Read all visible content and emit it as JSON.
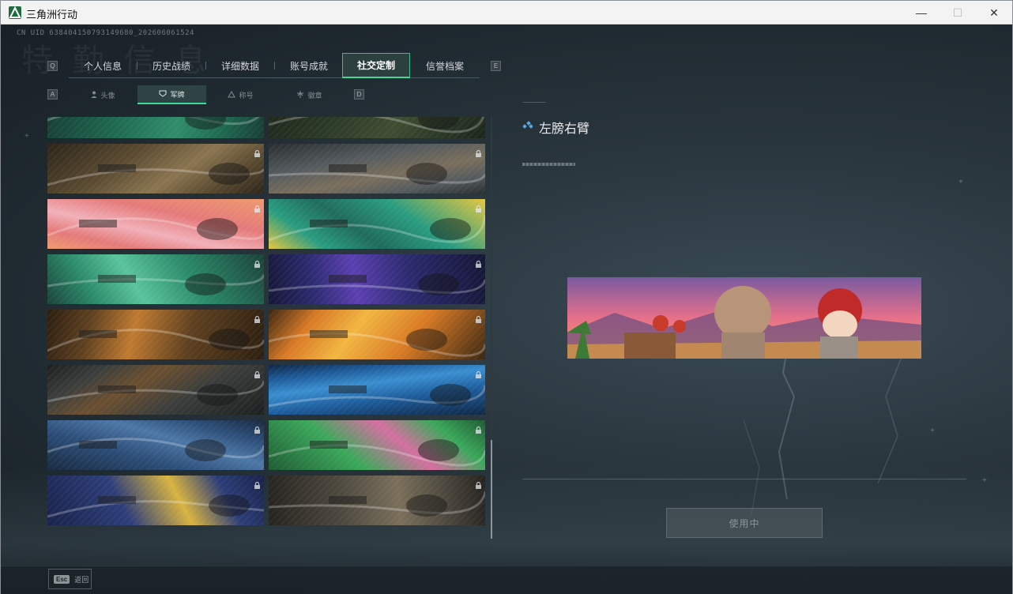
{
  "window": {
    "title": "三角洲行动",
    "minimize": "—",
    "maximize": "☐",
    "close": "✕"
  },
  "header": {
    "uid": "CN UID 638404150793149680_202606061524",
    "bg_title": "特 勤 信 息"
  },
  "tabs": {
    "prev_key": "Q",
    "next_key": "E",
    "items": [
      {
        "label": "个人信息",
        "active": false
      },
      {
        "label": "历史战绩",
        "active": false
      },
      {
        "label": "详细数据",
        "active": false
      },
      {
        "label": "账号成就",
        "active": false
      },
      {
        "label": "社交定制",
        "active": true
      },
      {
        "label": "信誉档案",
        "active": false
      }
    ]
  },
  "subtabs": {
    "prev_key": "A",
    "next_key": "D",
    "items": [
      {
        "label": "头像",
        "icon": "person-icon",
        "active": false
      },
      {
        "label": "军牌",
        "icon": "shield-icon",
        "active": true
      },
      {
        "label": "称号",
        "icon": "triangle-icon",
        "active": false
      },
      {
        "label": "徽章",
        "icon": "badge-icon",
        "active": false
      }
    ]
  },
  "cards": [
    {
      "name": "card-drone-green",
      "colors": [
        "#1f6b52",
        "#2f8d6b",
        "#183d33"
      ],
      "locked": false,
      "selected": true
    },
    {
      "name": "card-dark-camo",
      "colors": [
        "#2c3a28",
        "#3f4d32",
        "#1b2418"
      ],
      "locked": false
    },
    {
      "name": "card-desert-convoy",
      "colors": [
        "#5a4a30",
        "#8a7550",
        "#2d251a"
      ],
      "locked": true
    },
    {
      "name": "card-tank-battle",
      "colors": [
        "#555b5e",
        "#7a6e5c",
        "#2a2e30"
      ],
      "locked": true
    },
    {
      "name": "card-pink-cats",
      "colors": [
        "#e47a7a",
        "#f1b0b8",
        "#ee9a6e"
      ],
      "locked": true
    },
    {
      "name": "card-teal-thumbs",
      "colors": [
        "#2a9d80",
        "#1f6b5c",
        "#e3c640"
      ],
      "locked": true
    },
    {
      "name": "card-green-drone-hand",
      "colors": [
        "#2b8a6a",
        "#59c49b",
        "#1b4238"
      ],
      "locked": true
    },
    {
      "name": "card-purple-lightning",
      "colors": [
        "#2a2a6e",
        "#5b3fb0",
        "#161636"
      ],
      "locked": true
    },
    {
      "name": "card-soldiers-fire",
      "colors": [
        "#5e4020",
        "#c07a30",
        "#2c1e10"
      ],
      "locked": true
    },
    {
      "name": "card-orange-burst",
      "colors": [
        "#d87a25",
        "#f2b640",
        "#3a2612"
      ],
      "locked": true
    },
    {
      "name": "card-ruins-office",
      "colors": [
        "#3a3d3c",
        "#6b4f30",
        "#1d1f1f"
      ],
      "locked": true
    },
    {
      "name": "card-blue-wave",
      "colors": [
        "#1d5b9a",
        "#3a8fd0",
        "#0f2744"
      ],
      "locked": true
    },
    {
      "name": "card-blue-spider",
      "colors": [
        "#2c4e78",
        "#4d77a6",
        "#182a40"
      ],
      "locked": true
    },
    {
      "name": "card-green-pink",
      "colors": [
        "#3aa85a",
        "#d46fa0",
        "#1f5a33"
      ],
      "locked": true
    },
    {
      "name": "card-yellow-stage",
      "colors": [
        "#2d3d78",
        "#d8b440",
        "#18224a"
      ],
      "locked": true
    },
    {
      "name": "card-wreck-field",
      "colors": [
        "#4f4a40",
        "#7a6f5a",
        "#25231f"
      ],
      "locked": true
    }
  ],
  "detail": {
    "title": "左膀右臂",
    "banner_colors": [
      "#f0a060",
      "#e6708a",
      "#7a5aa0",
      "#d8a860"
    ],
    "use_button": "使用中"
  },
  "footer": {
    "esc_key": "Esc",
    "back_label": "返回"
  }
}
